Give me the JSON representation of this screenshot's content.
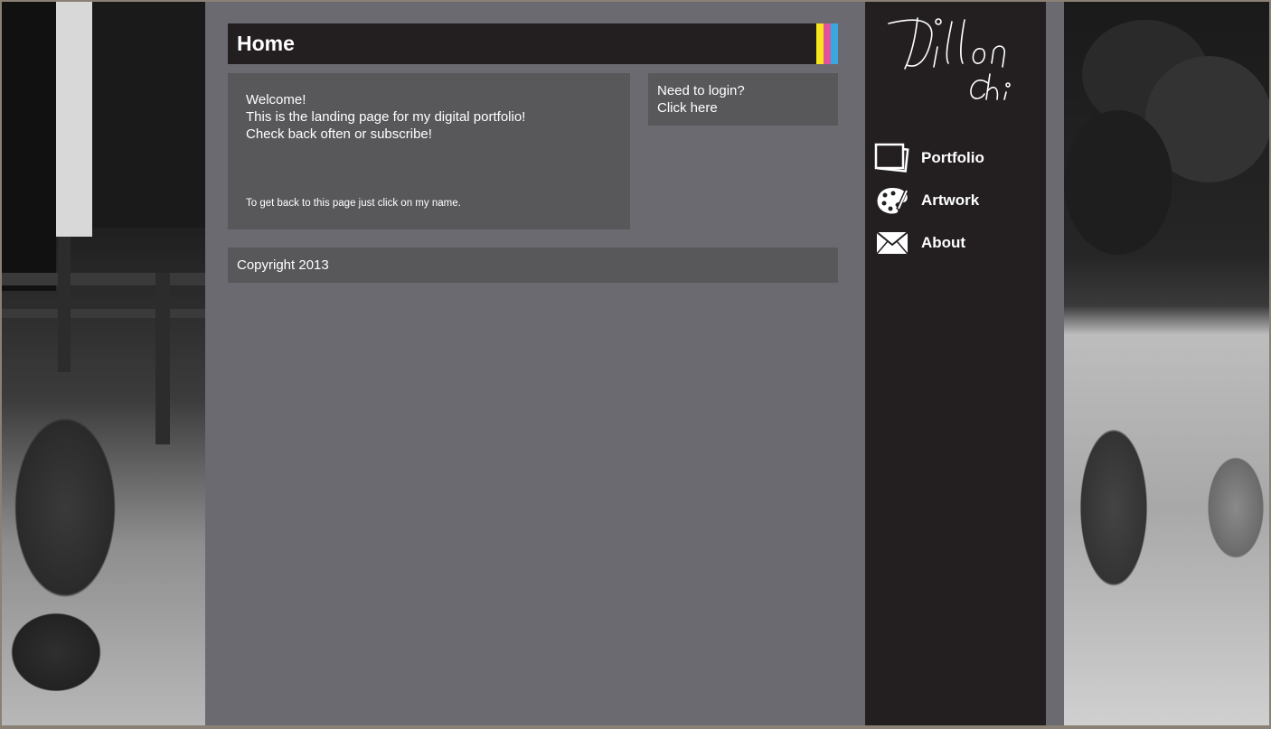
{
  "header": {
    "title": "Home"
  },
  "accent_stripes": [
    "#f6e51b",
    "#e0529c",
    "#3aa8e0"
  ],
  "welcome": {
    "lines": [
      "Welcome!",
      "This is the landing page for my digital portfolio!",
      "Check back often or subscribe!"
    ],
    "return_note": "To get back to this page just click on my name."
  },
  "login": {
    "prompt": "Need to login?",
    "link": "Click here"
  },
  "footer": {
    "copyright": "Copyright 2013"
  },
  "sidebar": {
    "signature_icon": "dillon-chi-signature-logo",
    "nav": [
      {
        "label": "Portfolio",
        "icon": "photo-frame-icon"
      },
      {
        "label": "Artwork",
        "icon": "palette-icon"
      },
      {
        "label": "About",
        "icon": "envelope-icon"
      }
    ]
  },
  "colors": {
    "content_bg": "#6a6a70",
    "panel_bg": "#58585b",
    "dark_bg": "#231f20",
    "text": "#ffffff"
  }
}
